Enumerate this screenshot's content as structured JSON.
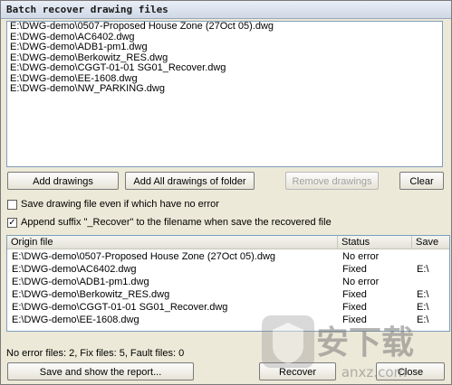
{
  "window": {
    "title": "Batch recover drawing files"
  },
  "files": [
    "E:\\DWG-demo\\0507-Proposed House Zone (27Oct 05).dwg",
    "E:\\DWG-demo\\AC6402.dwg",
    "E:\\DWG-demo\\ADB1-pm1.dwg",
    "E:\\DWG-demo\\Berkowitz_RES.dwg",
    "E:\\DWG-demo\\CGGT-01-01 SG01_Recover.dwg",
    "E:\\DWG-demo\\EE-1608.dwg",
    "E:\\DWG-demo\\NW_PARKING.dwg"
  ],
  "buttons": {
    "add_drawings": "Add drawings",
    "add_all": "Add All drawings of folder",
    "remove": "Remove drawings",
    "clear": "Clear",
    "save_report": "Save and show the report...",
    "recover": "Recover",
    "close": "Close"
  },
  "options": {
    "save_even_no_error": {
      "label": "Save drawing file even if which have no error",
      "checked": false
    },
    "append_suffix": {
      "label": "Append suffix \"_Recover\" to the filename when save the recovered file",
      "checked": true
    }
  },
  "results": {
    "columns": [
      "Origin file",
      "Status",
      "Save"
    ],
    "rows": [
      {
        "origin": "E:\\DWG-demo\\0507-Proposed House Zone (27Oct 05).dwg",
        "status": "No error",
        "save": ""
      },
      {
        "origin": "E:\\DWG-demo\\AC6402.dwg",
        "status": "Fixed",
        "save": "E:\\"
      },
      {
        "origin": "E:\\DWG-demo\\ADB1-pm1.dwg",
        "status": "No error",
        "save": ""
      },
      {
        "origin": "E:\\DWG-demo\\Berkowitz_RES.dwg",
        "status": "Fixed",
        "save": "E:\\"
      },
      {
        "origin": "E:\\DWG-demo\\CGGT-01-01 SG01_Recover.dwg",
        "status": "Fixed",
        "save": "E:\\"
      },
      {
        "origin": "E:\\DWG-demo\\EE-1608.dwg",
        "status": "Fixed",
        "save": "E:\\"
      }
    ]
  },
  "summary": "No error files: 2, Fix files: 5, Fault files: 0",
  "watermark": {
    "text": "安下载",
    "subtext": "anxz.com"
  }
}
